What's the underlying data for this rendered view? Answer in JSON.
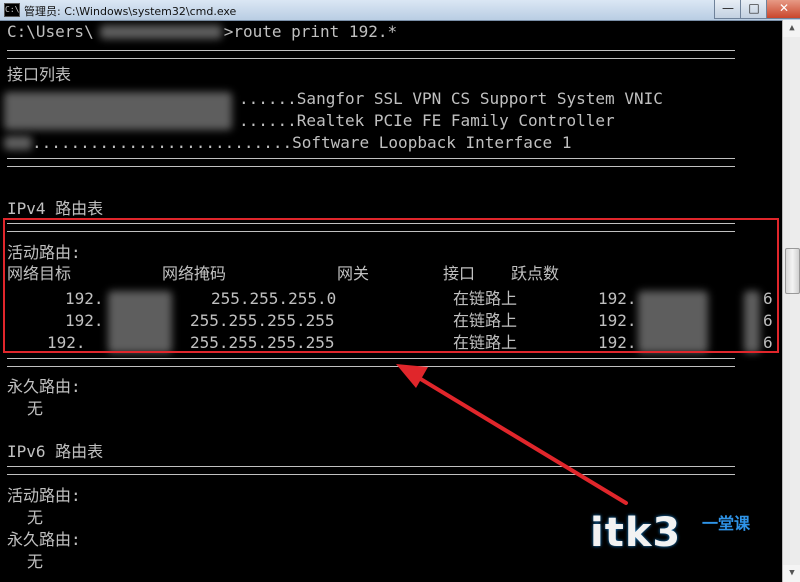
{
  "window": {
    "title": "管理员: C:\\Windows\\system32\\cmd.exe",
    "app_icon": "C:\\",
    "minimize_glyph": "—",
    "maximize_glyph": "□",
    "close_glyph": "✕"
  },
  "console": {
    "prompt_prefix": "C:\\Users\\",
    "prompt_command": ">route print 192.*",
    "interface_list_title": "接口列表",
    "interfaces": [
      {
        "dots": "......",
        "name": "Sangfor SSL VPN CS Support System VNIC"
      },
      {
        "dots": "......",
        "name": "Realtek PCIe FE Family Controller"
      },
      {
        "dots": "...........................",
        "name": "Software Loopback Interface 1"
      }
    ],
    "ipv4_title": "IPv4 路由表",
    "active_routes_title": "活动路由:",
    "columns": [
      "网络目标",
      "网络掩码",
      "网关",
      "接口",
      "跃点数"
    ],
    "routes": [
      {
        "destination": "192.",
        "mask": "255.255.255.0",
        "gateway": "在链路上",
        "interface": "192.",
        "metric": "6"
      },
      {
        "destination": "192.",
        "mask": "255.255.255.255",
        "gateway": "在链路上",
        "interface": "192.",
        "metric": "6"
      },
      {
        "destination": "192.",
        "mask": "255.255.255.255",
        "gateway": "在链路上",
        "interface": "192.",
        "metric": "6"
      }
    ],
    "persistent_routes_title": "永久路由:",
    "none": "无",
    "ipv6_title": "IPv6 路由表"
  },
  "watermark": {
    "main": "itk3",
    "side": "一堂课"
  },
  "colors": {
    "console_bg": "#000000",
    "console_text": "#c0c0c0",
    "highlight": "#e0262b"
  }
}
